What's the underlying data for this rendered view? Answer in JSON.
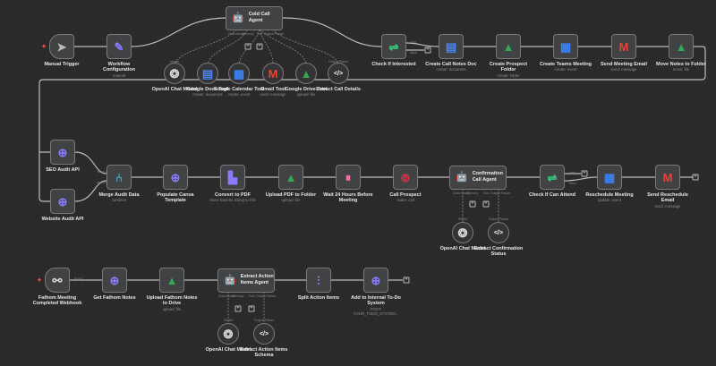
{
  "workflow": {
    "nodes": [
      {
        "id": "manual",
        "label": "Manual Trigger",
        "icon": "cursor-icon",
        "kind": "trigger"
      },
      {
        "id": "config",
        "label": "Workflow Configuration",
        "subtitle": "manual",
        "icon": "pencil-icon"
      },
      {
        "id": "coldagent",
        "label": "Cold Call Agent",
        "icon": "robot-icon",
        "kind": "agent"
      },
      {
        "id": "openai1",
        "label": "OpenAI Chat Model",
        "icon": "openai-icon",
        "kind": "circle"
      },
      {
        "id": "docs",
        "label": "Google Docs Tool",
        "subtitle": "create: document",
        "icon": "google-docs-icon",
        "kind": "circle"
      },
      {
        "id": "cal",
        "label": "Google Calendar Tool",
        "subtitle": "create: event",
        "icon": "google-calendar-icon",
        "kind": "circle"
      },
      {
        "id": "gmail",
        "label": "Gmail Tool",
        "subtitle": "send: message",
        "icon": "gmail-icon",
        "kind": "circle"
      },
      {
        "id": "drive",
        "label": "Google Drive Tool",
        "subtitle": "upload: file",
        "icon": "google-drive-icon",
        "kind": "circle"
      },
      {
        "id": "extract1",
        "label": "Extract Call Details",
        "icon": "code-icon",
        "kind": "circle"
      },
      {
        "id": "checkint",
        "label": "Check If Interested",
        "icon": "if-icon"
      },
      {
        "id": "notesdoc",
        "label": "Create Call Notes Doc",
        "subtitle": "create: document",
        "icon": "google-docs-icon"
      },
      {
        "id": "folder",
        "label": "Create Prospect Folder",
        "subtitle": "create: folder",
        "icon": "google-drive-icon"
      },
      {
        "id": "teams",
        "label": "Create Teams Meeting",
        "subtitle": "create: event",
        "icon": "google-calendar-icon"
      },
      {
        "id": "sendmail",
        "label": "Send Meeting Email",
        "subtitle": "send: message",
        "icon": "gmail-icon"
      },
      {
        "id": "move",
        "label": "Move Notes to Folder",
        "subtitle": "move: file",
        "icon": "google-drive-icon"
      },
      {
        "id": "seo",
        "label": "SEO Audit API",
        "icon": "globe-icon"
      },
      {
        "id": "web",
        "label": "Website Audit API",
        "icon": "globe-icon"
      },
      {
        "id": "merge",
        "label": "Merge Audit Data",
        "subtitle": "combine",
        "icon": "merge-icon"
      },
      {
        "id": "canva",
        "label": "Populate Canva Template",
        "icon": "globe-icon"
      },
      {
        "id": "pdf",
        "label": "Convert to PDF",
        "subtitle": "Move Base64 String to File",
        "icon": "file-convert-icon"
      },
      {
        "id": "uploadpdf",
        "label": "Upload PDF to Folder",
        "subtitle": "upload: file",
        "icon": "google-drive-icon"
      },
      {
        "id": "wait",
        "label": "Wait 24 Hours Before Meeting",
        "icon": "pause-icon"
      },
      {
        "id": "call",
        "label": "Call Prospect",
        "subtitle": "make: call",
        "icon": "phone-icon"
      },
      {
        "id": "confagent",
        "label": "Confirmation Call Agent",
        "icon": "robot-icon",
        "kind": "agent"
      },
      {
        "id": "openai2",
        "label": "OpenAI Chat Model",
        "icon": "openai-icon",
        "kind": "circle"
      },
      {
        "id": "extract2",
        "label": "Extract Confirmation Status",
        "icon": "code-icon",
        "kind": "circle"
      },
      {
        "id": "checkattend",
        "label": "Check If Can Attend",
        "icon": "if-icon"
      },
      {
        "id": "resched",
        "label": "Reschedule Meeting",
        "subtitle": "update: event",
        "icon": "google-calendar-icon"
      },
      {
        "id": "reschedmail",
        "label": "Send Reschedule Email",
        "subtitle": "send: message",
        "icon": "gmail-icon"
      },
      {
        "id": "fathom",
        "label": "Fathom Meeting Completed Webhook",
        "icon": "webhook-icon",
        "kind": "trigger"
      },
      {
        "id": "getnotes",
        "label": "Get Fathom Notes",
        "icon": "globe-icon"
      },
      {
        "id": "uploadnotes",
        "label": "Upload Fathom Notes to Drive",
        "subtitle": "upload: file",
        "icon": "google-drive-icon"
      },
      {
        "id": "actionagent",
        "label": "Extract Action Items Agent",
        "icon": "robot-icon",
        "kind": "agent"
      },
      {
        "id": "openai3",
        "label": "OpenAI Chat Model",
        "icon": "openai-icon",
        "kind": "circle"
      },
      {
        "id": "schema",
        "label": "Extract Action Items Schema",
        "icon": "code-icon",
        "kind": "circle"
      },
      {
        "id": "split",
        "label": "Split Action Items",
        "icon": "split-icon"
      },
      {
        "id": "todo",
        "label": "Add to Internal To-Do System",
        "subtitle": "POST: YOUR_TODO_SYSTEM...",
        "icon": "globe-icon"
      }
    ],
    "port_labels": {
      "chat_model": "Chat Model",
      "memory": "Memory",
      "tool": "Tool",
      "output_parser": "Output Parser",
      "model": "Model",
      "true": "true",
      "false": "false",
      "input1": "Input 1",
      "input2": "Input 2",
      "post": "POST"
    }
  },
  "colors": {
    "canvas": "#2a2a2b",
    "node": "#414244",
    "wire": "#bdbdbd",
    "trigger_marker": "#ff4a4a"
  }
}
